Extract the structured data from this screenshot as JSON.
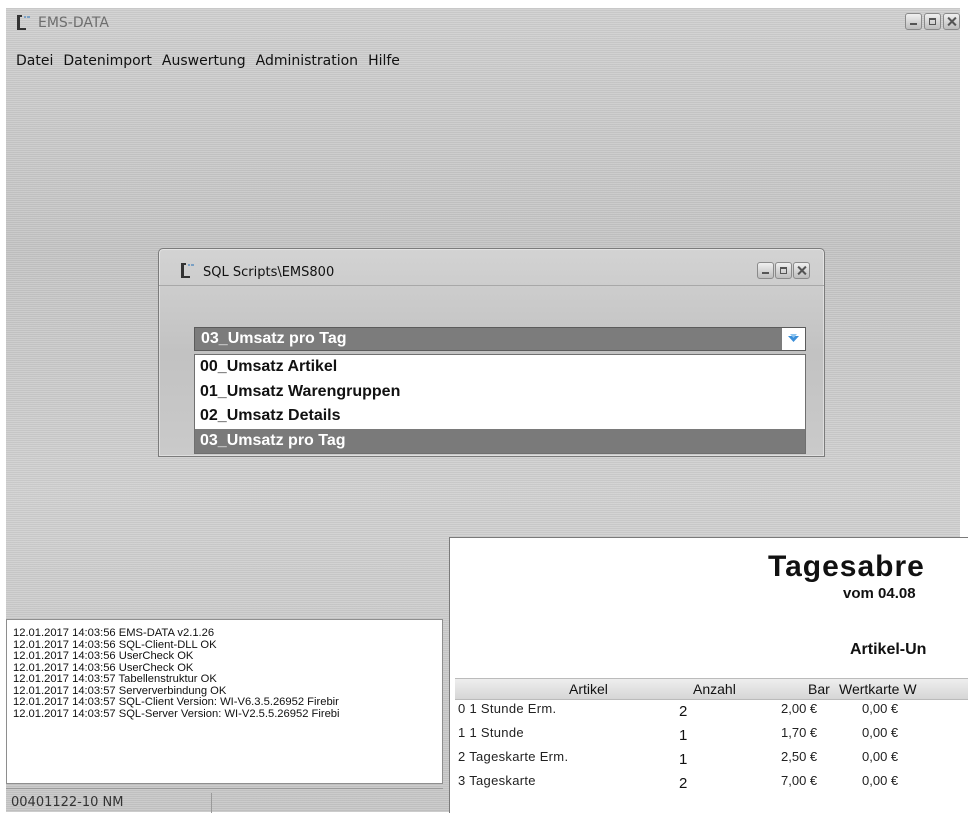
{
  "app": {
    "title": "EMS-DATA"
  },
  "menu": [
    "Datei",
    "Datenimport",
    "Auswertung",
    "Administration",
    "Hilfe"
  ],
  "dialog": {
    "title": "SQL Scripts\\EMS800",
    "selected": "03_Umsatz pro Tag",
    "options": [
      "00_Umsatz Artikel",
      "01_Umsatz Warengruppen",
      "02_Umsatz Details",
      "03_Umsatz pro Tag"
    ]
  },
  "log": [
    "12.01.2017 14:03:56 EMS-DATA v2.1.26",
    "12.01.2017 14:03:56 SQL-Client-DLL OK",
    "12.01.2017 14:03:56 UserCheck OK",
    "12.01.2017 14:03:56 UserCheck OK",
    "12.01.2017 14:03:57 Tabellenstruktur OK",
    "12.01.2017 14:03:57 Serververbindung OK",
    "12.01.2017 14:03:57 SQL-Client Version: WI-V6.3.5.26952 Firebir",
    "12.01.2017 14:03:57 SQL-Server Version: WI-V2.5.5.26952 Firebi"
  ],
  "status": {
    "code": "00401122-10 NM"
  },
  "report": {
    "title": "Tagesabre",
    "subtitle": "vom 04.08",
    "section": "Artikel-Un",
    "headers": {
      "artikel": "Artikel",
      "anzahl": "Anzahl",
      "bar": "Bar",
      "wertkarte": "Wertkarte W"
    },
    "rows": [
      {
        "artikel": "0 1 Stunde Erm.",
        "anzahl": "2",
        "bar": "2,00 €",
        "wertkarte": "0,00 €"
      },
      {
        "artikel": "1 1 Stunde",
        "anzahl": "1",
        "bar": "1,70 €",
        "wertkarte": "0,00 €"
      },
      {
        "artikel": "2 Tageskarte Erm.",
        "anzahl": "1",
        "bar": "2,50 €",
        "wertkarte": "0,00 €"
      },
      {
        "artikel": "3 Tageskarte",
        "anzahl": "2",
        "bar": "7,00 €",
        "wertkarte": "0,00 €"
      }
    ]
  }
}
